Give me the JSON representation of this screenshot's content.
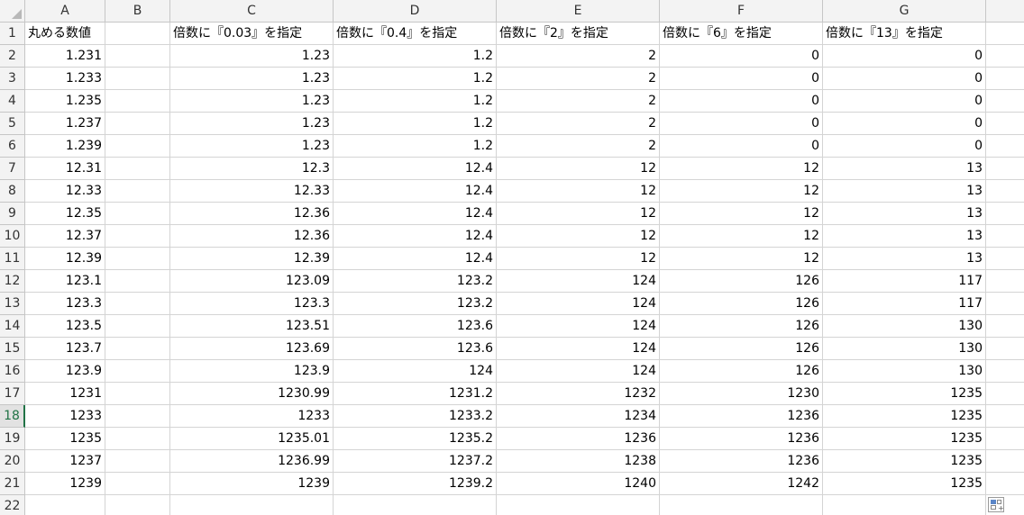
{
  "columns": [
    "A",
    "B",
    "C",
    "D",
    "E",
    "F",
    "G",
    ""
  ],
  "rows": [
    {
      "n": "1",
      "a": "丸める数値",
      "b": "",
      "c": "倍数に『0.03』を指定",
      "d": "倍数に『0.4』を指定",
      "e": "倍数に『2』を指定",
      "f": "倍数に『6』を指定",
      "g": "倍数に『13』を指定"
    },
    {
      "n": "2",
      "a": "1.231",
      "b": "",
      "c": "1.23",
      "d": "1.2",
      "e": "2",
      "f": "0",
      "g": "0"
    },
    {
      "n": "3",
      "a": "1.233",
      "b": "",
      "c": "1.23",
      "d": "1.2",
      "e": "2",
      "f": "0",
      "g": "0"
    },
    {
      "n": "4",
      "a": "1.235",
      "b": "",
      "c": "1.23",
      "d": "1.2",
      "e": "2",
      "f": "0",
      "g": "0"
    },
    {
      "n": "5",
      "a": "1.237",
      "b": "",
      "c": "1.23",
      "d": "1.2",
      "e": "2",
      "f": "0",
      "g": "0"
    },
    {
      "n": "6",
      "a": "1.239",
      "b": "",
      "c": "1.23",
      "d": "1.2",
      "e": "2",
      "f": "0",
      "g": "0"
    },
    {
      "n": "7",
      "a": "12.31",
      "b": "",
      "c": "12.3",
      "d": "12.4",
      "e": "12",
      "f": "12",
      "g": "13"
    },
    {
      "n": "8",
      "a": "12.33",
      "b": "",
      "c": "12.33",
      "d": "12.4",
      "e": "12",
      "f": "12",
      "g": "13"
    },
    {
      "n": "9",
      "a": "12.35",
      "b": "",
      "c": "12.36",
      "d": "12.4",
      "e": "12",
      "f": "12",
      "g": "13"
    },
    {
      "n": "10",
      "a": "12.37",
      "b": "",
      "c": "12.36",
      "d": "12.4",
      "e": "12",
      "f": "12",
      "g": "13"
    },
    {
      "n": "11",
      "a": "12.39",
      "b": "",
      "c": "12.39",
      "d": "12.4",
      "e": "12",
      "f": "12",
      "g": "13"
    },
    {
      "n": "12",
      "a": "123.1",
      "b": "",
      "c": "123.09",
      "d": "123.2",
      "e": "124",
      "f": "126",
      "g": "117"
    },
    {
      "n": "13",
      "a": "123.3",
      "b": "",
      "c": "123.3",
      "d": "123.2",
      "e": "124",
      "f": "126",
      "g": "117"
    },
    {
      "n": "14",
      "a": "123.5",
      "b": "",
      "c": "123.51",
      "d": "123.6",
      "e": "124",
      "f": "126",
      "g": "130"
    },
    {
      "n": "15",
      "a": "123.7",
      "b": "",
      "c": "123.69",
      "d": "123.6",
      "e": "124",
      "f": "126",
      "g": "130"
    },
    {
      "n": "16",
      "a": "123.9",
      "b": "",
      "c": "123.9",
      "d": "124",
      "e": "124",
      "f": "126",
      "g": "130"
    },
    {
      "n": "17",
      "a": "1231",
      "b": "",
      "c": "1230.99",
      "d": "1231.2",
      "e": "1232",
      "f": "1230",
      "g": "1235"
    },
    {
      "n": "18",
      "a": "1233",
      "b": "",
      "c": "1233",
      "d": "1233.2",
      "e": "1234",
      "f": "1236",
      "g": "1235"
    },
    {
      "n": "19",
      "a": "1235",
      "b": "",
      "c": "1235.01",
      "d": "1235.2",
      "e": "1236",
      "f": "1236",
      "g": "1235"
    },
    {
      "n": "20",
      "a": "1237",
      "b": "",
      "c": "1236.99",
      "d": "1237.2",
      "e": "1238",
      "f": "1236",
      "g": "1235"
    },
    {
      "n": "21",
      "a": "1239",
      "b": "",
      "c": "1239",
      "d": "1239.2",
      "e": "1240",
      "f": "1242",
      "g": "1235"
    },
    {
      "n": "22",
      "a": "",
      "b": "",
      "c": "",
      "d": "",
      "e": "",
      "f": "",
      "g": ""
    }
  ],
  "active_row": "18",
  "colors": {
    "header_bg": "#f3f3f3",
    "gridline": "#d4d4d4",
    "active_accent": "#217346"
  },
  "quick_analysis_icon": "quick-analysis-icon"
}
